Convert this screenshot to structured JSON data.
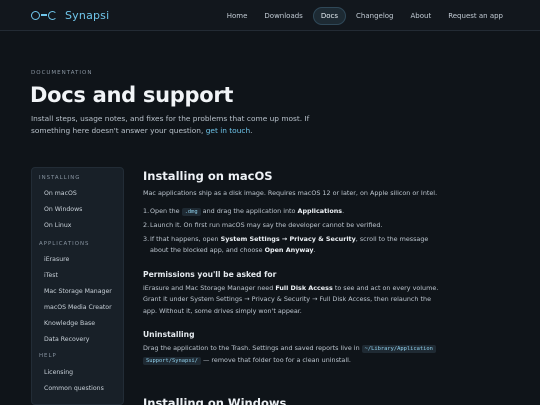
{
  "header": {
    "brand": "Synapsi",
    "nav": [
      {
        "label": "Home"
      },
      {
        "label": "Downloads"
      },
      {
        "label": "Docs",
        "active": true
      },
      {
        "label": "Changelog"
      },
      {
        "label": "About"
      },
      {
        "label": "Request an app"
      }
    ]
  },
  "hero": {
    "eyebrow": "DOCUMENTATION",
    "title": "Docs and support",
    "subtitle_pre": "Install steps, usage notes, and fixes for the problems that come up most. If something here doesn't answer your question, ",
    "subtitle_link": "get in touch",
    "subtitle_post": "."
  },
  "sidebar": {
    "installing_head": "INSTALLING",
    "installing": [
      "On macOS",
      "On Windows",
      "On Linux"
    ],
    "applications_head": "APPLICATIONS",
    "applications": [
      "iErasure",
      "iTest",
      "Mac Storage Manager",
      "macOS Media Creator",
      "Knowledge Base",
      "Data Recovery"
    ],
    "help_head": "HELP",
    "help": [
      "Licensing",
      "Common questions"
    ]
  },
  "content": {
    "mac_title": "Installing on macOS",
    "mac_intro": "Mac applications ship as a disk image. Requires macOS 12 or later, on Apple silicon or Intel.",
    "step1_num": "1.",
    "step1_a": "Open the",
    "step1_code": ".dmg",
    "step1_b": "and drag the application into",
    "step1_bold": "Applications",
    "step1_c": ".",
    "step2_num": "2.",
    "step2": "Launch it. On first run macOS may say the developer cannot be verified.",
    "step3_num": "3.",
    "step3_a": "If that happens, open",
    "step3_bold1": "System Settings → Privacy & Security",
    "step3_b": ", scroll to the message about the blocked app, and choose",
    "step3_bold2": "Open Anyway",
    "step3_c": ".",
    "perm_title": "Permissions you'll be asked for",
    "perm_a": "iErasure and Mac Storage Manager need",
    "perm_bold": "Full Disk Access",
    "perm_b": "to see and act on every volume. Grant it under System Settings → Privacy & Security → Full Disk Access, then relaunch the app. Without it, some drives simply won't appear.",
    "uninst_title": "Uninstalling",
    "uninst_a": "Drag the application to the Trash. Settings and saved reports live in",
    "uninst_code1": "~/Library/Application",
    "uninst_code2": "Support/Synapsi/",
    "uninst_b": "— remove that folder too for a clean uninstall.",
    "win_title": "Installing on Windows"
  }
}
